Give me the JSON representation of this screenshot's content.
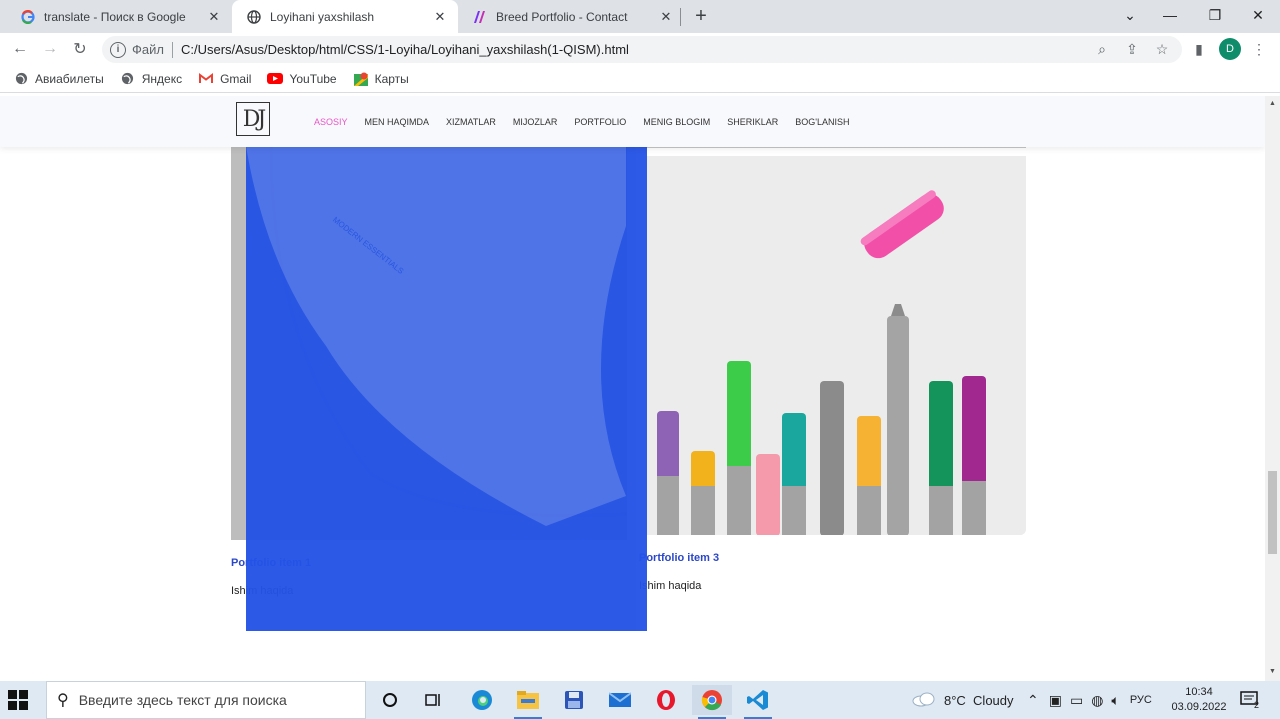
{
  "browser": {
    "tabs": [
      {
        "title": "translate - Поиск в Google",
        "icon": "google-g-icon",
        "active": false
      },
      {
        "title": "Loyihani yaxshilash",
        "icon": "globe-icon",
        "active": true
      },
      {
        "title": "Breed Portfolio - Contact",
        "icon": "breed-logo-icon",
        "active": false
      }
    ],
    "address": {
      "scheme_label": "Файл",
      "url": "C:/Users/Asus/Desktop/html/CSS/1-Loyiha/Loyihani_yaxshilash(1-QISM).html"
    },
    "profile_initial": "D",
    "bookmarks": [
      {
        "label": "Авиабилеты",
        "icon": "globe-icon"
      },
      {
        "label": "Яндекс",
        "icon": "globe-icon"
      },
      {
        "label": "Gmail",
        "icon": "gmail-icon"
      },
      {
        "label": "YouTube",
        "icon": "youtube-icon"
      },
      {
        "label": "Карты",
        "icon": "maps-icon"
      }
    ]
  },
  "site": {
    "logo_text": "DJ",
    "menu": [
      {
        "label": "ASOSIY",
        "active": true
      },
      {
        "label": "MEN HAQIMDA",
        "active": false
      },
      {
        "label": "XIZMATLAR",
        "active": false
      },
      {
        "label": "MIJOZLAR",
        "active": false
      },
      {
        "label": "PORTFOLIO",
        "active": false
      },
      {
        "label": "MENIG BLOGIM",
        "active": false
      },
      {
        "label": "SHERIKLAR",
        "active": false
      },
      {
        "label": "BOG'LANISH",
        "active": false
      }
    ],
    "portfolio": [
      {
        "title": "Portfolio item 1",
        "desc": "Ishim haqida",
        "image": "tshirt-photo",
        "label_on_shirt": "MODERN ESSENTIALS"
      },
      {
        "title": "Portfolio item 3",
        "desc": "Ishim haqida",
        "image": "markers-photo"
      }
    ],
    "overlay_color": "#2453e6",
    "accent_color": "#e855c9"
  },
  "taskbar": {
    "search_placeholder": "Введите здесь текст для поиска",
    "weather": "8°C  Cloudy",
    "language": "РУС",
    "time": "10:34",
    "date": "03.09.2022",
    "notifications": "2"
  }
}
